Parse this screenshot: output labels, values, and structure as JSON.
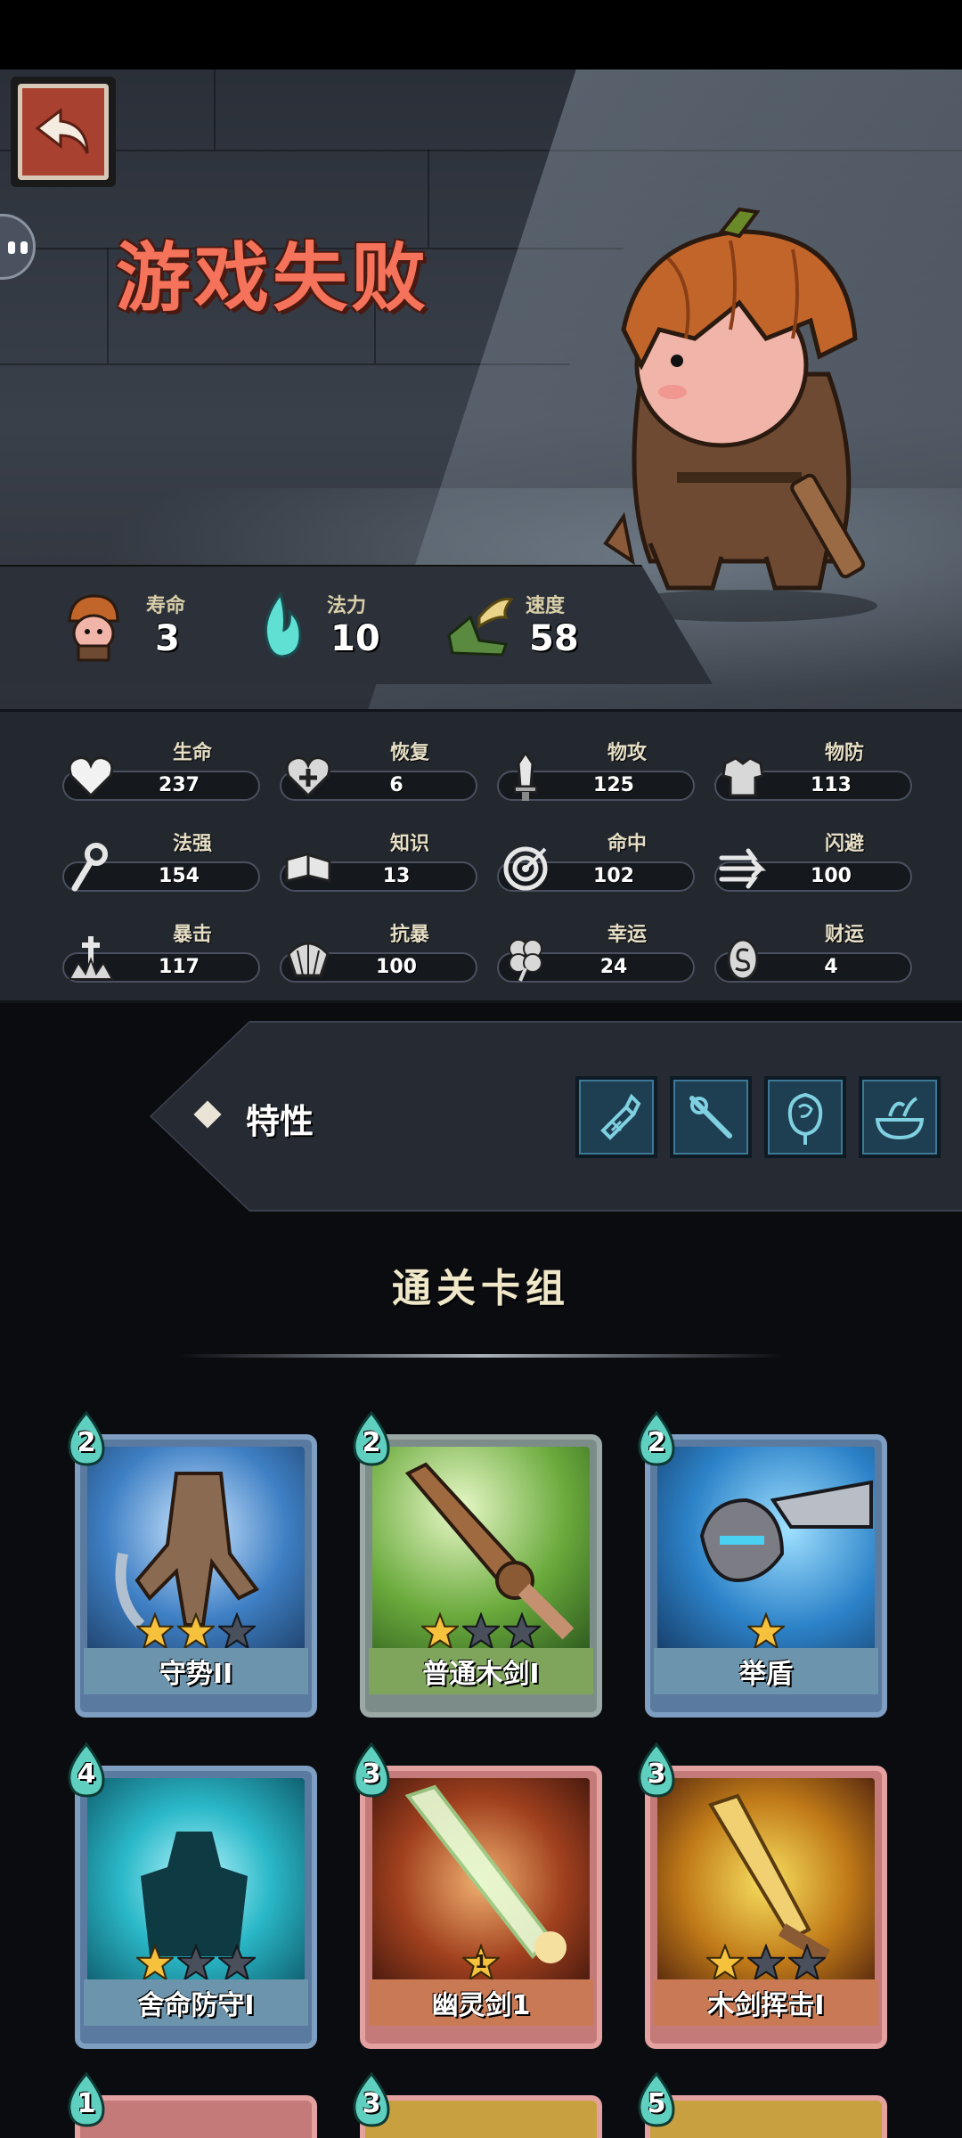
{
  "screen": {
    "title": "游戏失败"
  },
  "summary": [
    {
      "label": "寿命",
      "value": "3",
      "icon": "character-face-icon"
    },
    {
      "label": "法力",
      "value": "10",
      "icon": "mana-flame-icon"
    },
    {
      "label": "速度",
      "value": "58",
      "icon": "winged-boot-icon"
    }
  ],
  "stats": [
    {
      "name": "生命",
      "value": "237",
      "icon": "heart-icon"
    },
    {
      "name": "恢复",
      "value": "6",
      "icon": "heart-plus-icon"
    },
    {
      "name": "物攻",
      "value": "125",
      "icon": "sword-icon"
    },
    {
      "name": "物防",
      "value": "113",
      "icon": "armor-icon"
    },
    {
      "name": "法强",
      "value": "154",
      "icon": "staff-icon"
    },
    {
      "name": "知识",
      "value": "13",
      "icon": "book-icon"
    },
    {
      "name": "命中",
      "value": "102",
      "icon": "target-icon"
    },
    {
      "name": "闪避",
      "value": "100",
      "icon": "dodge-arrows-icon"
    },
    {
      "name": "暴击",
      "value": "117",
      "icon": "crit-icon"
    },
    {
      "name": "抗暴",
      "value": "100",
      "icon": "shell-shield-icon"
    },
    {
      "name": "幸运",
      "value": "24",
      "icon": "clover-icon"
    },
    {
      "name": "财运",
      "value": "4",
      "icon": "coin-icon"
    }
  ],
  "traits": {
    "label": "特性",
    "icons": [
      "potion-trait-icon",
      "wand-trait-icon",
      "rose-trait-icon",
      "bowl-trait-icon"
    ]
  },
  "deck": {
    "title": "通关卡组",
    "cards": [
      {
        "name": "守势II",
        "cost": "2",
        "rarity": "blue",
        "stars": 2,
        "max_stars": 3,
        "level_badge": ""
      },
      {
        "name": "普通木剑I",
        "cost": "2",
        "rarity": "green",
        "stars": 1,
        "max_stars": 3,
        "level_badge": ""
      },
      {
        "name": "举盾",
        "cost": "2",
        "rarity": "blue",
        "stars": 1,
        "max_stars": 1,
        "level_badge": ""
      },
      {
        "name": "舍命防守I",
        "cost": "4",
        "rarity": "blue",
        "stars": 1,
        "max_stars": 3,
        "level_badge": ""
      },
      {
        "name": "幽灵剑1",
        "cost": "3",
        "rarity": "orange",
        "stars": 1,
        "max_stars": 1,
        "level_badge": "1"
      },
      {
        "name": "木剑挥击I",
        "cost": "3",
        "rarity": "orange",
        "stars": 1,
        "max_stars": 3,
        "level_badge": ""
      }
    ],
    "partial_cards": [
      {
        "cost": "1"
      },
      {
        "cost": "3"
      },
      {
        "cost": "5"
      }
    ]
  },
  "colors": {
    "title": "#f4735a",
    "back_button": "#a8412f",
    "mana": "#5fe0d2",
    "star_on": "#f6c23e",
    "star_off": "#4a4f5c"
  }
}
